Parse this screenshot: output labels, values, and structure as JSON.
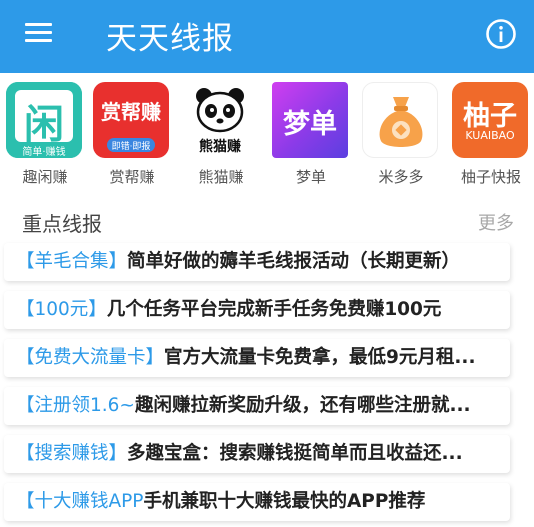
{
  "header": {
    "title": "天天线报",
    "menu_icon": "hamburger-menu-icon",
    "info_icon": "info-circle-icon",
    "bg_color": "#2d9ae8"
  },
  "apps": [
    {
      "label": "趣闲赚",
      "icon_text": "闲",
      "icon_sub": "简单·赚钱"
    },
    {
      "label": "赏帮赚",
      "icon_text": "赏帮赚",
      "icon_sub": "即错·即报"
    },
    {
      "label": "熊猫赚",
      "icon_text": "熊猫赚"
    },
    {
      "label": "梦单",
      "icon_text": "梦单"
    },
    {
      "label": "米多多",
      "icon_text": "money-bag-icon"
    },
    {
      "label": "柚子快报",
      "icon_text": "柚子",
      "icon_sub": "KUAIBAO"
    }
  ],
  "section": {
    "title": "重点线报",
    "more": "更多"
  },
  "news": [
    {
      "tag": "【羊毛合集】",
      "title": "简单好做的薅羊毛线报活动（长期更新）"
    },
    {
      "tag": "【100元】",
      "title": "几个任务平台完成新手任务免费赚100元"
    },
    {
      "tag": "【免费大流量卡】",
      "title": "官方大流量卡免费拿，最低9元月租..."
    },
    {
      "tag": "【注册领1.6~",
      "title": "趣闲赚拉新奖励升级，还有哪些注册就..."
    },
    {
      "tag": "【搜索赚钱】",
      "title": "多趣宝盒：搜索赚钱挺简单而且收益还..."
    },
    {
      "tag": "【十大赚钱APP",
      "title": "手机兼职十大赚钱最快的APP推荐"
    }
  ]
}
